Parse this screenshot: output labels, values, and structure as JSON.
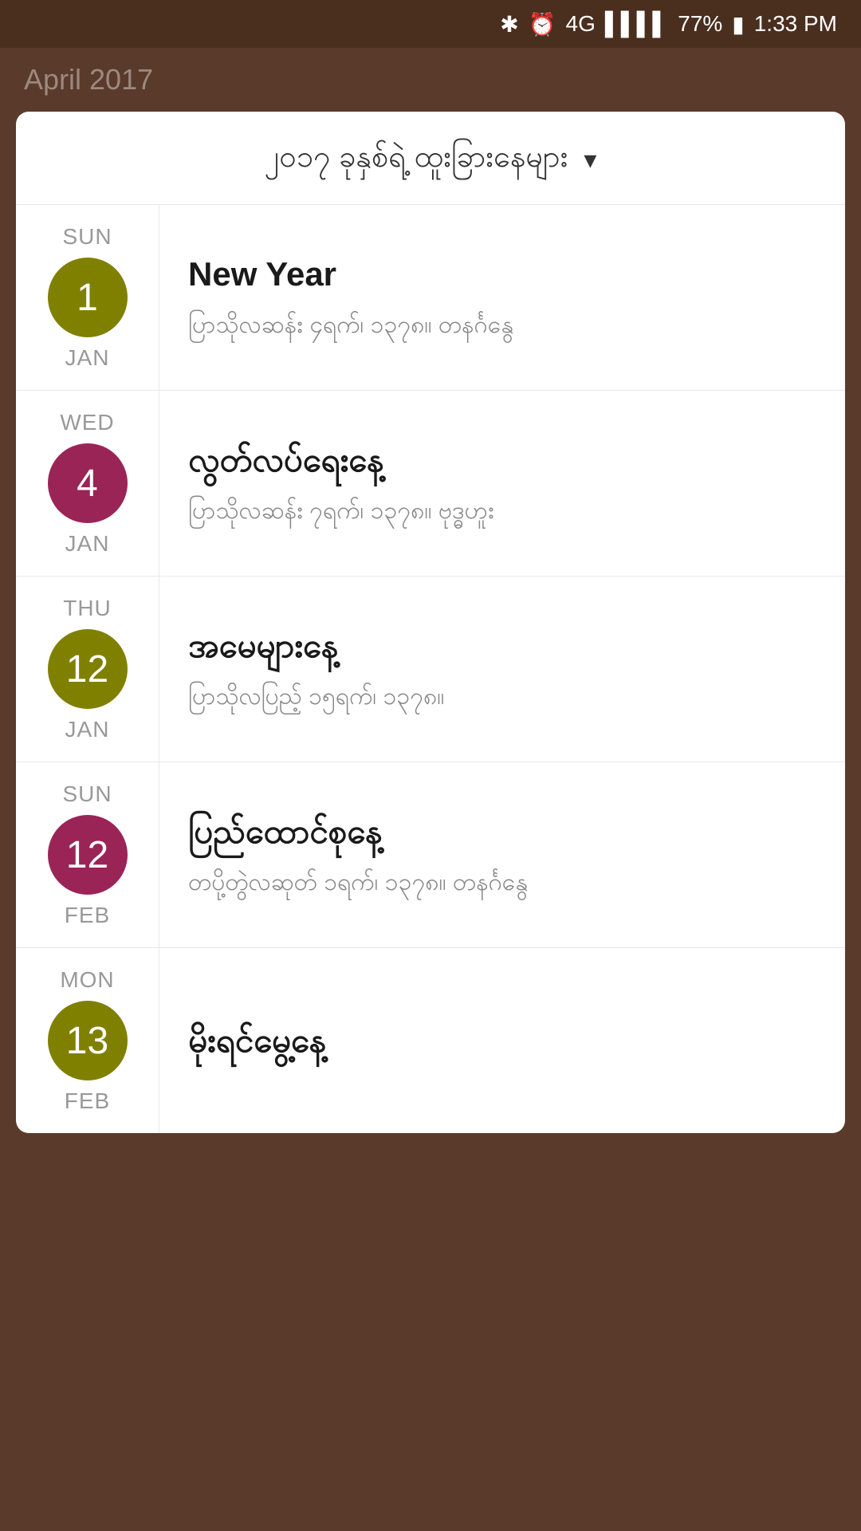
{
  "statusBar": {
    "bluetooth": "✱",
    "alarm": "⏰",
    "network": "4G",
    "signal": "▌▌▌▌",
    "battery": "77%",
    "batteryIcon": "🔋",
    "time": "1:33 PM"
  },
  "bgTitle": "April 2017",
  "header": {
    "title": "၂၀၁၇ ခုနှစ်ရဲ့ ထူးခြားနေများ",
    "chevron": "▾"
  },
  "holidays": [
    {
      "dayName": "SUN",
      "dateNum": "1",
      "monthName": "JAN",
      "circleColor": "olive",
      "title": "New Year",
      "desc": "ပြာသိုလဆန်း ၄ရက်၊ ၁၃၇၈။ တနင်္ဂနွေ"
    },
    {
      "dayName": "WED",
      "dateNum": "4",
      "monthName": "JAN",
      "circleColor": "purple",
      "title": "လွတ်လပ်ရေးနေ့",
      "desc": "ပြာသိုလဆန်း ၇ရက်၊ ၁၃၇၈။ ဗုဒ္ဓဟူး"
    },
    {
      "dayName": "THU",
      "dateNum": "12",
      "monthName": "JAN",
      "circleColor": "olive",
      "title": "အမေများနေ့",
      "desc": "ပြာသိုလပြည့် ၁၅ရက်၊ ၁၃၇၈။"
    },
    {
      "dayName": "SUN",
      "dateNum": "12",
      "monthName": "FEB",
      "circleColor": "purple",
      "title": "ပြည်ထောင်စုနေ့",
      "desc": "တပို့တွဲလဆုတ် ၁ရက်၊ ၁၃၇၈။ တနင်္ဂနွေ"
    },
    {
      "dayName": "MON",
      "dateNum": "13",
      "monthName": "FEB",
      "circleColor": "olive",
      "title": "မိုးရင်မွေ့နေ့",
      "desc": ""
    }
  ]
}
